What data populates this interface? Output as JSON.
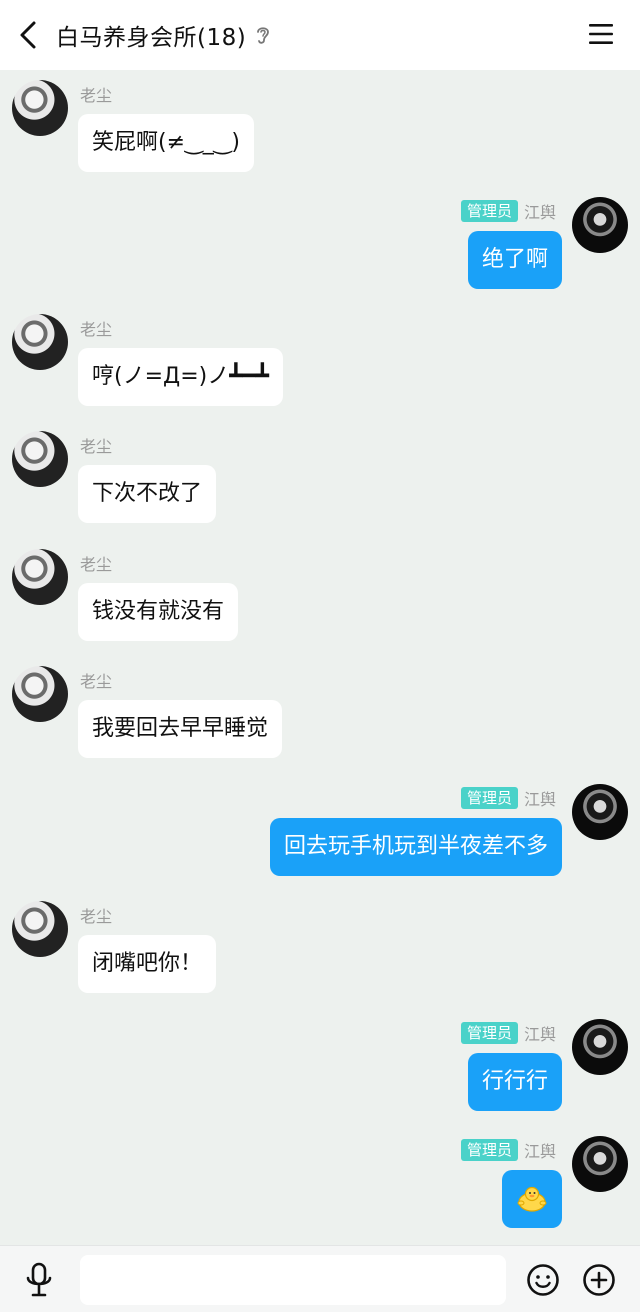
{
  "header": {
    "title": "白马养身会所(18)",
    "icons": [
      "back-icon",
      "ear-icon",
      "menu-icon"
    ]
  },
  "messages": [
    {
      "side": "left",
      "sender": "老尘",
      "text": "笑屁啊(≠‿_‿)"
    },
    {
      "side": "right",
      "badge": "管理员",
      "sender": "江舆",
      "text": "绝了啊"
    },
    {
      "side": "left",
      "sender": "老尘",
      "text": "哼(ノ=Д=)ノ┻━┻"
    },
    {
      "side": "left",
      "sender": "老尘",
      "text": "下次不改了"
    },
    {
      "side": "left",
      "sender": "老尘",
      "text": "钱没有就没有"
    },
    {
      "side": "left",
      "sender": "老尘",
      "text": "我要回去早早睡觉"
    },
    {
      "side": "right",
      "badge": "管理员",
      "sender": "江舆",
      "text": "回去玩手机玩到半夜差不多"
    },
    {
      "side": "left",
      "sender": "老尘",
      "text": "闭嘴吧你！"
    },
    {
      "side": "right",
      "badge": "管理员",
      "sender": "江舆",
      "text": "行行行"
    },
    {
      "side": "right",
      "badge": "管理员",
      "sender": "江舆",
      "sticker": "duck-sticker"
    }
  ],
  "input": {
    "placeholder": "",
    "value": ""
  },
  "colors": {
    "background": "#edf1ee",
    "outgoing_bubble": "#1aa1f8",
    "incoming_bubble": "#ffffff",
    "admin_badge": "#4ad2c9"
  }
}
